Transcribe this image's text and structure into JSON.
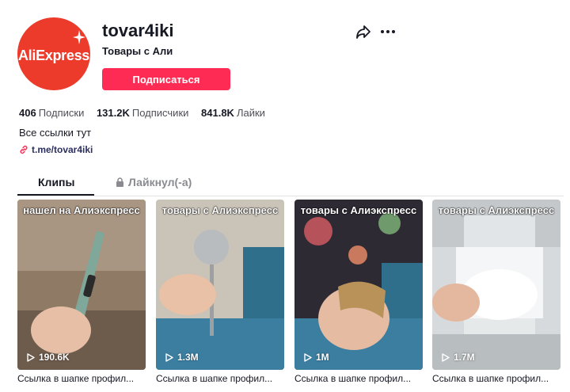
{
  "profile": {
    "avatar_text": "AliExpress",
    "username": "tovar4iki",
    "nickname": "Товары с Али",
    "follow_label": "Подписаться"
  },
  "stats": [
    {
      "value": "406",
      "label": "Подписки"
    },
    {
      "value": "131.2K",
      "label": "Подписчики"
    },
    {
      "value": "841.8K",
      "label": "Лайки"
    }
  ],
  "bio": "Все ссылки тут",
  "bio_link": "t.me/tovar4iki",
  "tabs": {
    "videos": "Клипы",
    "liked": "Лайкнул(-а)"
  },
  "videos": [
    {
      "overlay": "нашел на Алиэкспресс",
      "views": "190.6K",
      "caption": "Ссылка в шапке профил..."
    },
    {
      "overlay": "товары с Алиэкспресс",
      "views": "1.3M",
      "caption": "Ссылка в шапке профил..."
    },
    {
      "overlay": "товары с Алиэкспресс",
      "views": "1M",
      "caption": "Ссылка в шапке профил..."
    },
    {
      "overlay": "товары с Алиэкспресс",
      "views": "1.7M",
      "caption": "Ссылка в шапке профил..."
    }
  ],
  "colors": {
    "accent": "#fe2c55",
    "avatar_bg": "#ec3b2a",
    "text": "#161823",
    "muted": "#8a8b91"
  },
  "icons": [
    "share-icon",
    "more-icon",
    "link-icon",
    "lock-icon",
    "play-icon",
    "sparkle-icon"
  ]
}
